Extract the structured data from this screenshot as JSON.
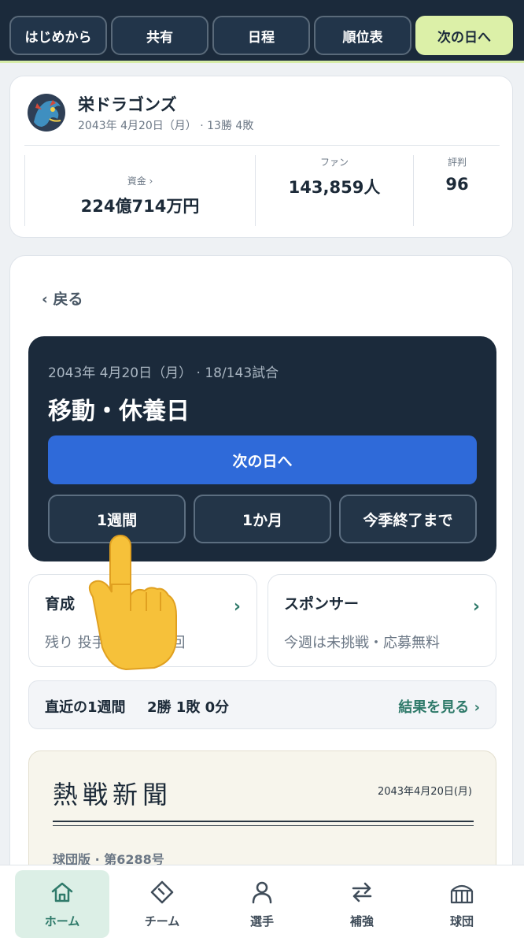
{
  "top_nav": [
    {
      "label": "はじめから"
    },
    {
      "label": "共有"
    },
    {
      "label": "日程"
    },
    {
      "label": "順位表"
    },
    {
      "label": "次の日へ"
    }
  ],
  "club": {
    "name": "栄ドラゴンズ",
    "subtitle": "2043年 4月20日（月） · 13勝 4敗",
    "stats": [
      {
        "label": "資金 ›",
        "value": "224億714万円"
      },
      {
        "label": "ファン",
        "value": "143,859人"
      },
      {
        "label": "評判",
        "value": "96"
      }
    ]
  },
  "main": {
    "back_label": "‹ 戻る",
    "day": {
      "date": "2043年 4月20日（月） · 18/143試合",
      "title": "移動・休養日",
      "next_label": "次の日へ",
      "skip_buttons": [
        "1週間",
        "1か月",
        "今季終了まで"
      ]
    },
    "training": {
      "title": "育成",
      "detail": "残り 投手0回 野手0回",
      "chevron": "›"
    },
    "sponsor": {
      "title": "スポンサー",
      "detail": "今週は未挑戦・応募無料",
      "chevron": "›"
    },
    "week": {
      "label": "直近の1週間",
      "record": "2勝 1敗 0分",
      "link": "結果を見る ›"
    },
    "newspaper": {
      "title": "熱戦新聞",
      "date": "2043年4月20日(月)",
      "issue": "球団版 · 第6288号"
    }
  },
  "bottom_nav": [
    {
      "label": "ホーム",
      "icon": "home-icon",
      "active": true
    },
    {
      "label": "チーム",
      "icon": "team-icon",
      "active": false
    },
    {
      "label": "選手",
      "icon": "player-icon",
      "active": false
    },
    {
      "label": "補強",
      "icon": "transfer-icon",
      "active": false
    },
    {
      "label": "球団",
      "icon": "stadium-icon",
      "active": false
    }
  ],
  "colors": {
    "navy": "#1b2a3b",
    "accent_lime": "#dcf0a8",
    "primary_blue": "#2f6ad9",
    "teal": "#2f7a6a"
  }
}
